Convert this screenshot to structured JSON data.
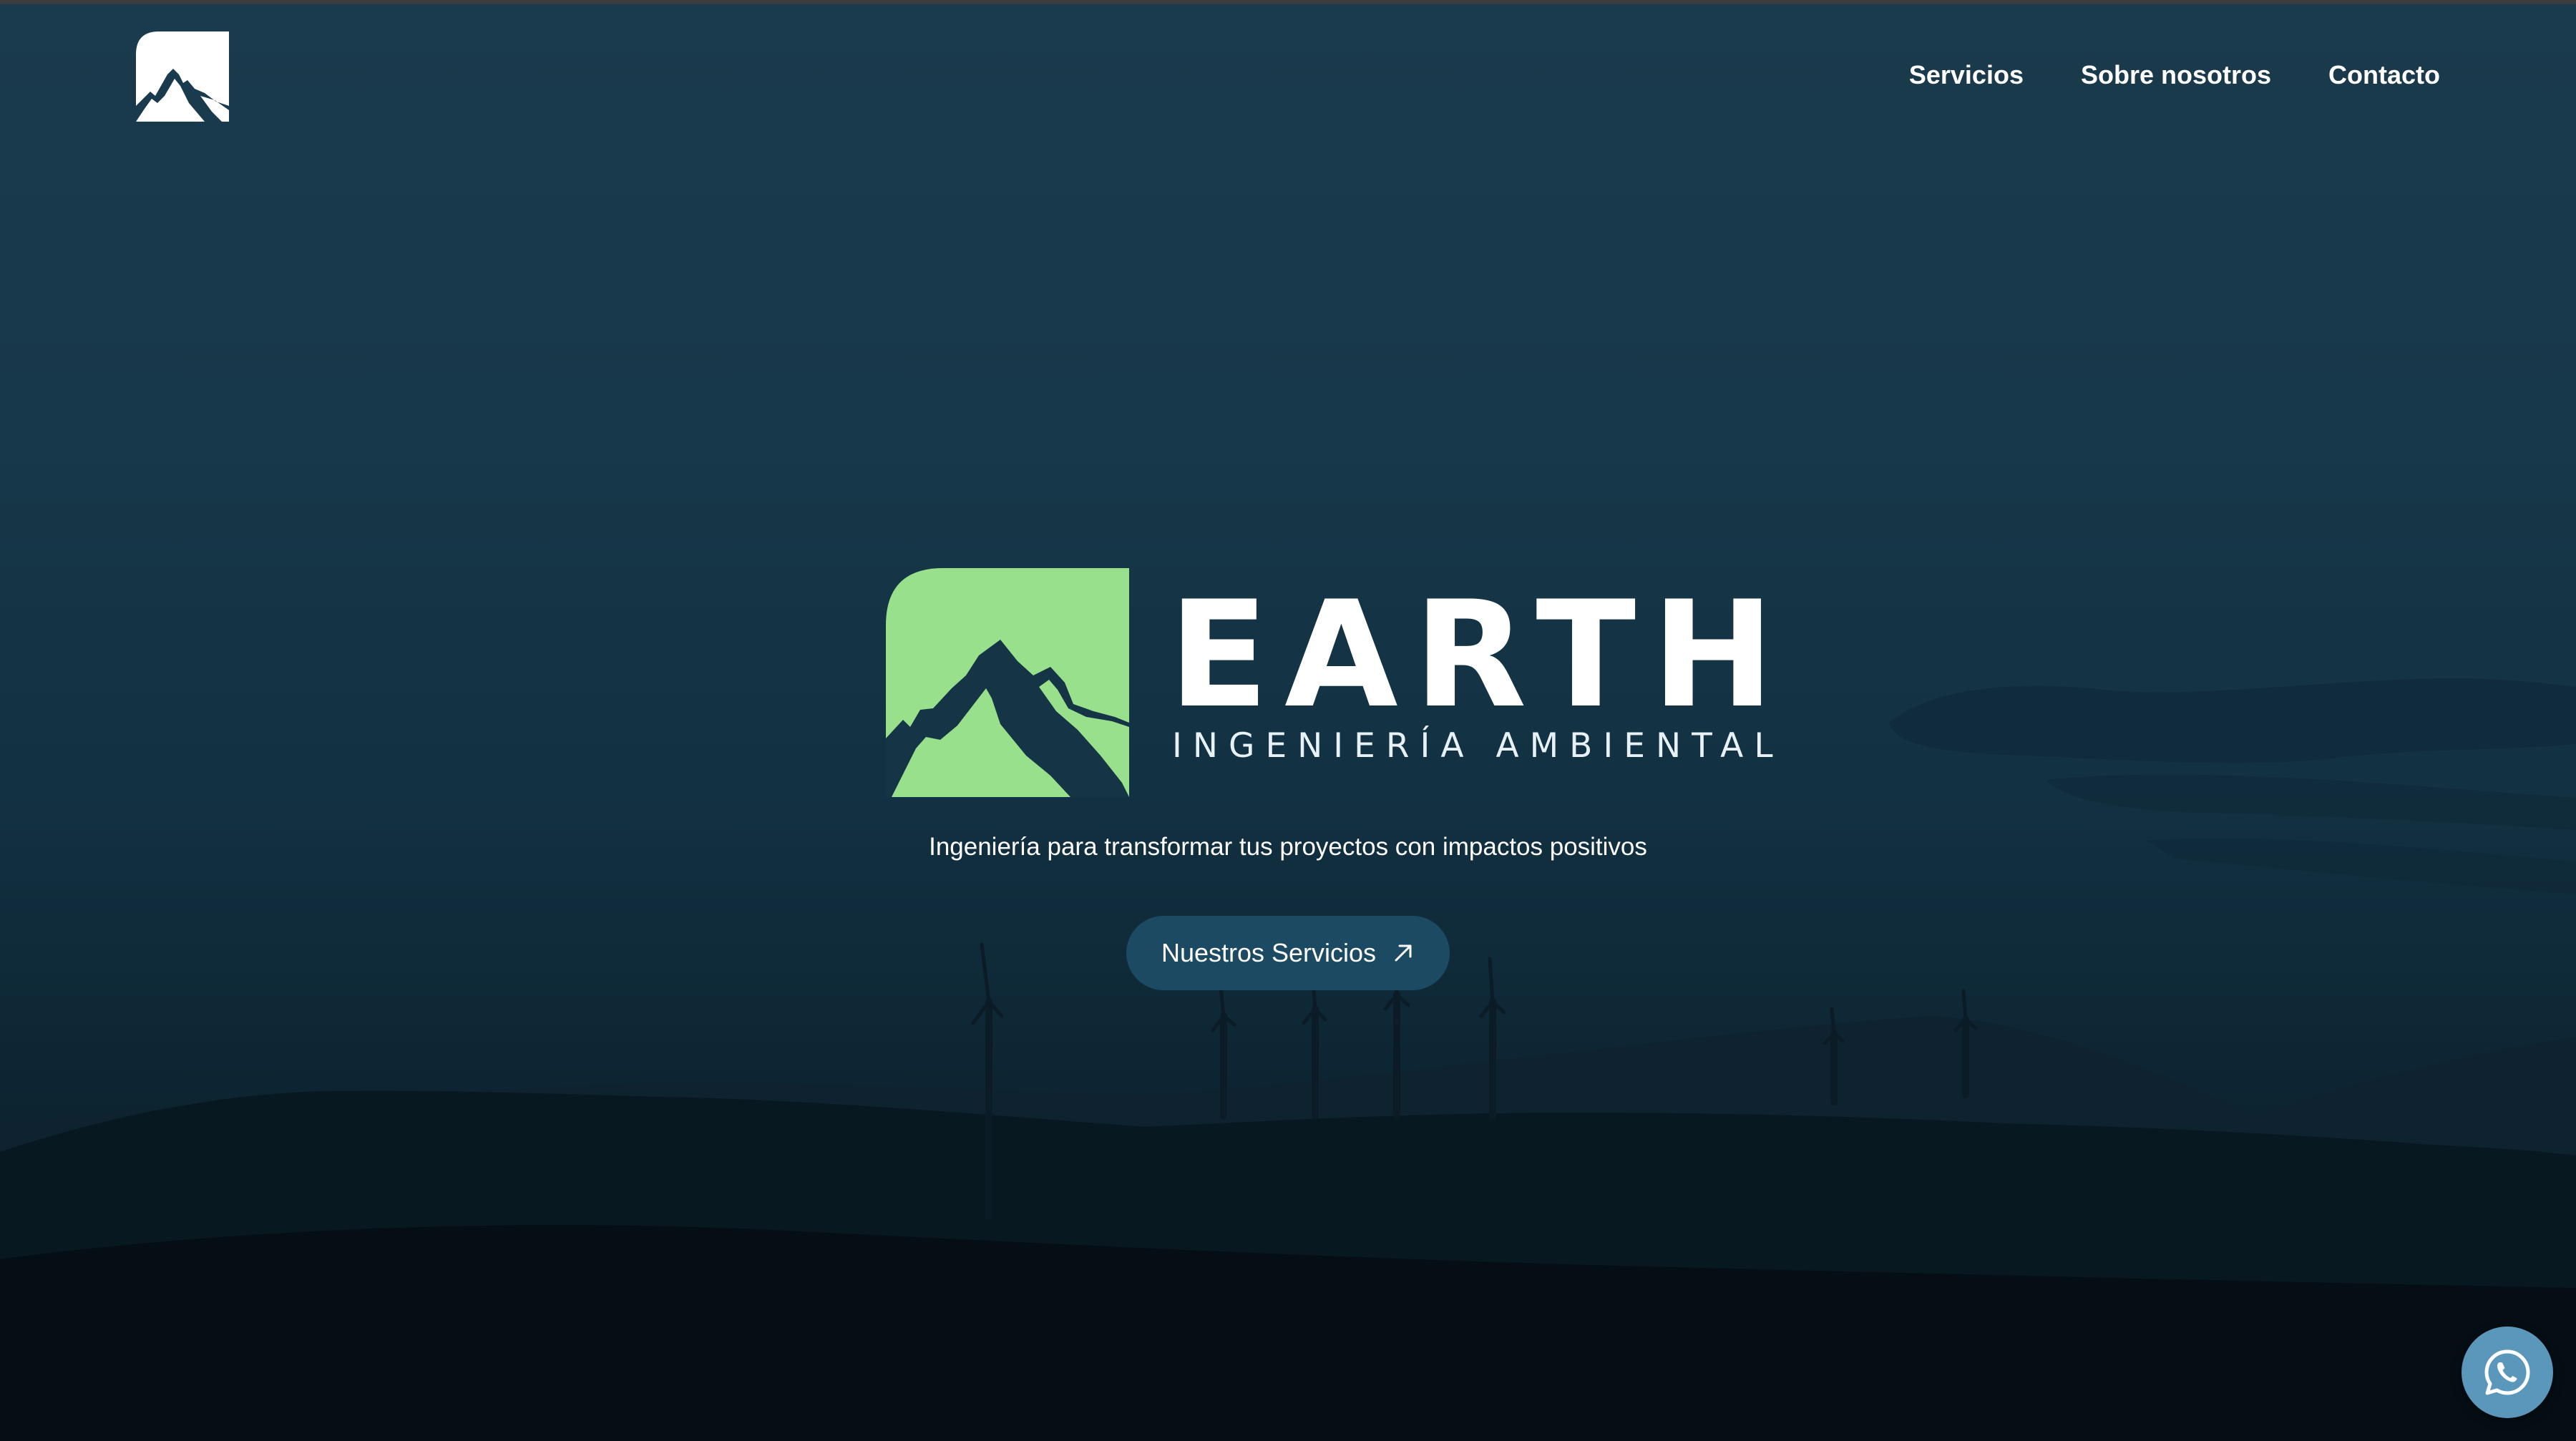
{
  "header": {
    "logo_icon": "mountain-logo-icon",
    "nav": [
      {
        "label": "Servicios"
      },
      {
        "label": "Sobre nosotros"
      },
      {
        "label": "Contacto"
      }
    ]
  },
  "hero": {
    "brand_name": "EARTH",
    "brand_subtitle": "INGENIERÍA AMBIENTAL",
    "tagline": "Ingeniería para transformar tus proyectos con impactos positivos",
    "cta_label": "Nuestros Servicios",
    "cta_icon": "arrow-up-right-icon"
  },
  "floating": {
    "whatsapp_icon": "whatsapp-icon"
  },
  "colors": {
    "brand_green": "#98e08b",
    "button_bg": "#1c4a62",
    "whatsapp_bg": "#5b97bb",
    "sky": "#17384a"
  }
}
